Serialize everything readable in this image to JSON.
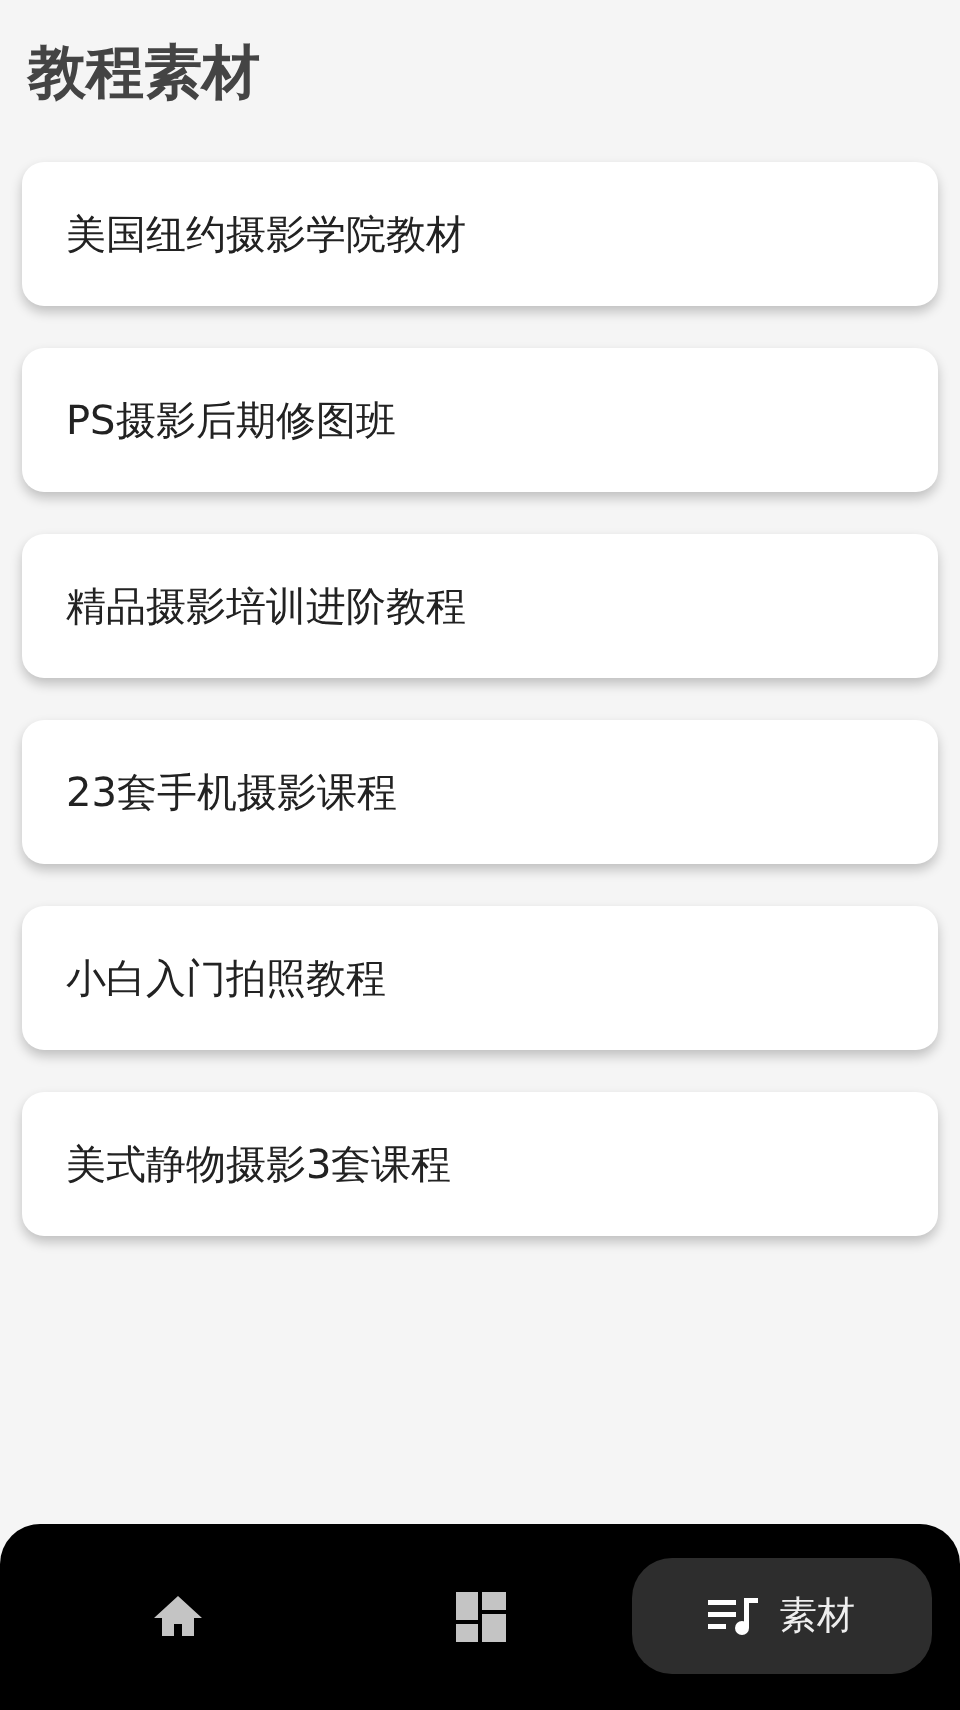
{
  "title": "教程素材",
  "items": [
    {
      "label": "美国纽约摄影学院教材"
    },
    {
      "label": "PS摄影后期修图班"
    },
    {
      "label": "精品摄影培训进阶教程"
    },
    {
      "label": "23套手机摄影课程"
    },
    {
      "label": "小白入门拍照教程"
    },
    {
      "label": "美式静物摄影3套课程"
    }
  ],
  "nav": [
    {
      "kind": "home",
      "selected": false
    },
    {
      "kind": "dashboard",
      "selected": false
    },
    {
      "kind": "library",
      "selected": true,
      "label": "素材"
    }
  ]
}
